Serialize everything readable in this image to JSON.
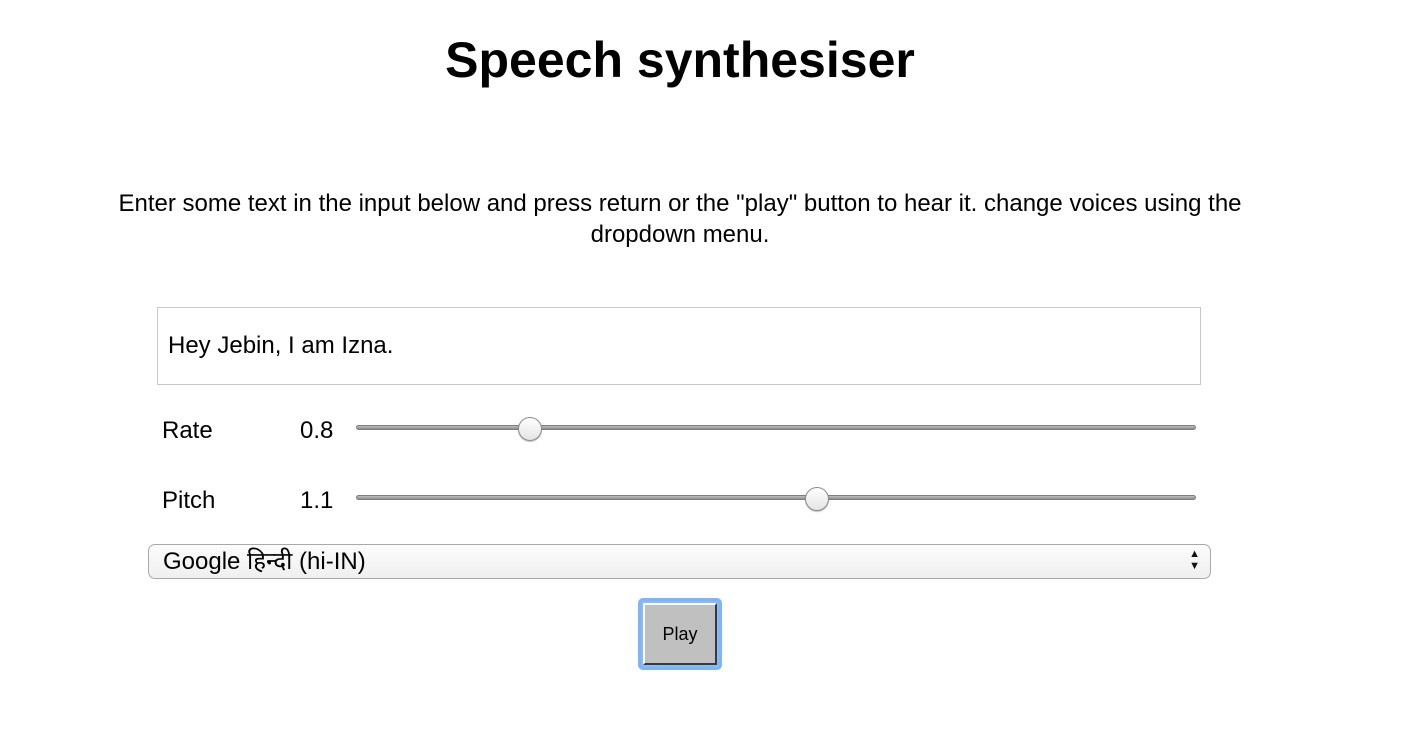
{
  "page": {
    "title": "Speech synthesiser",
    "instructions": "Enter some text in the input below and press return or the \"play\" button to hear it. change voices using the dropdown menu."
  },
  "text_input": {
    "value": "Hey Jebin, I am Izna."
  },
  "rate": {
    "label": "Rate",
    "value": "0.8",
    "level": 0.8,
    "min": 0.5,
    "max": 2
  },
  "pitch": {
    "label": "Pitch",
    "value": "1.1",
    "level": 1.1,
    "min": 0,
    "max": 2
  },
  "voice_select": {
    "selected": "Google हिन्दी (hi-IN)",
    "arrow_icon": "up-down-arrows-icon"
  },
  "play_button": {
    "label": "Play",
    "focus_color": "#7cb6f9"
  }
}
